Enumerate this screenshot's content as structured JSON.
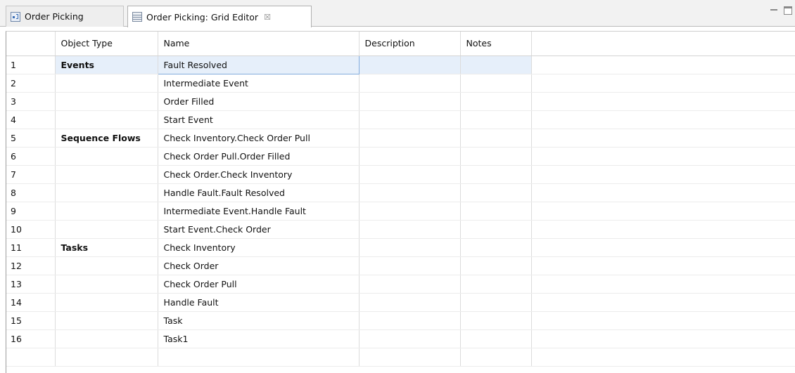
{
  "tabs": [
    {
      "label": "Order Picking",
      "icon": "diagram-icon"
    },
    {
      "label": "Order Picking: Grid Editor",
      "icon": "grid-icon",
      "close": "☒"
    }
  ],
  "grid": {
    "columns": [
      "Object Type",
      "Name",
      "Description",
      "Notes"
    ],
    "selected_row": 1,
    "rows": [
      {
        "num": "1",
        "type": "Events",
        "name": "Fault Resolved",
        "description": "",
        "notes": ""
      },
      {
        "num": "2",
        "type": "",
        "name": "Intermediate Event",
        "description": "",
        "notes": ""
      },
      {
        "num": "3",
        "type": "",
        "name": "Order Filled",
        "description": "",
        "notes": ""
      },
      {
        "num": "4",
        "type": "",
        "name": "Start Event",
        "description": "",
        "notes": ""
      },
      {
        "num": "5",
        "type": "Sequence Flows",
        "name": "Check Inventory.Check Order Pull",
        "description": "",
        "notes": ""
      },
      {
        "num": "6",
        "type": "",
        "name": "Check Order Pull.Order Filled",
        "description": "",
        "notes": ""
      },
      {
        "num": "7",
        "type": "",
        "name": "Check Order.Check Inventory",
        "description": "",
        "notes": ""
      },
      {
        "num": "8",
        "type": "",
        "name": "Handle Fault.Fault Resolved",
        "description": "",
        "notes": ""
      },
      {
        "num": "9",
        "type": "",
        "name": "Intermediate Event.Handle Fault",
        "description": "",
        "notes": ""
      },
      {
        "num": "10",
        "type": "",
        "name": "Start Event.Check Order",
        "description": "",
        "notes": ""
      },
      {
        "num": "11",
        "type": "Tasks",
        "name": "Check Inventory",
        "description": "",
        "notes": ""
      },
      {
        "num": "12",
        "type": "",
        "name": "Check Order",
        "description": "",
        "notes": ""
      },
      {
        "num": "13",
        "type": "",
        "name": "Check Order Pull",
        "description": "",
        "notes": ""
      },
      {
        "num": "14",
        "type": "",
        "name": "Handle Fault",
        "description": "",
        "notes": ""
      },
      {
        "num": "15",
        "type": "",
        "name": "Task",
        "description": "",
        "notes": ""
      },
      {
        "num": "16",
        "type": "",
        "name": "Task1",
        "description": "",
        "notes": ""
      }
    ]
  },
  "colors": {
    "selection": "#e6effa",
    "selection_border": "#84acdd"
  }
}
